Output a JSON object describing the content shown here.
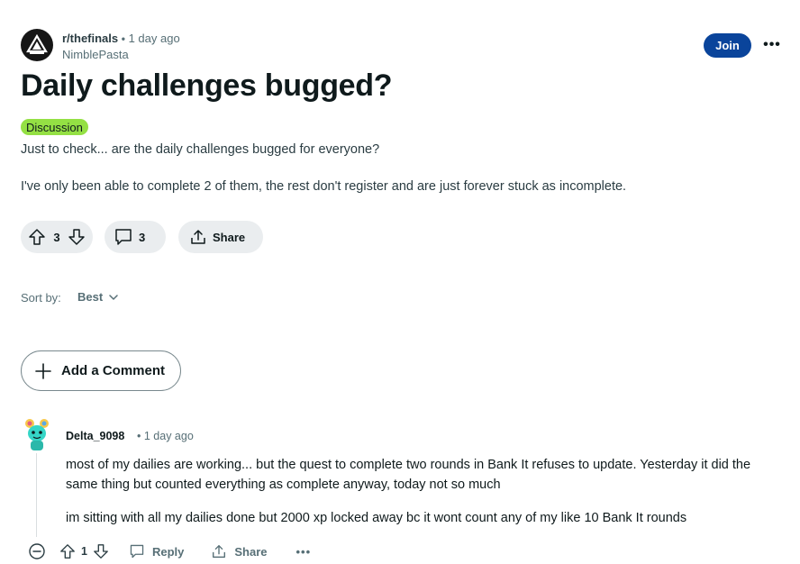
{
  "post": {
    "subreddit": "r/thefinals",
    "separator": "•",
    "time": "1 day ago",
    "author": "NimblePasta",
    "join_label": "Join",
    "more_label": "•••",
    "title": "Daily challenges bugged?",
    "flair": "Discussion",
    "flair_color": "#94e044",
    "body": [
      "Just to check... are the daily challenges bugged for everyone?",
      "I've only been able to complete 2 of them, the rest don't register and are just forever stuck as incomplete."
    ],
    "votes": "3",
    "comments": "3",
    "share_label": "Share"
  },
  "sort": {
    "label": "Sort by:",
    "value": "Best"
  },
  "add_comment_label": "Add a Comment",
  "comment": {
    "author": "Delta_9098",
    "separator": "•",
    "time": "1 day ago",
    "body": [
      "most of my dailies are working... but the quest to complete two rounds in Bank It refuses to update. Yesterday it did the same thing but counted everything as complete anyway, today not so much",
      "im sitting with all my dailies done but 2000 xp locked away bc it wont count any of my like 10 Bank It rounds"
    ],
    "votes": "1",
    "reply_label": "Reply",
    "share_label": "Share",
    "more_label": "•••"
  },
  "colors": {
    "join_button": "#0a449b",
    "pill_background": "#eaedef",
    "muted_text": "#576f76"
  },
  "icons": [
    "subreddit-logo-icon",
    "upvote-icon",
    "downvote-icon",
    "comment-icon",
    "share-icon",
    "chevron-down-icon",
    "plus-icon",
    "collapse-icon",
    "user-avatar-icon"
  ]
}
